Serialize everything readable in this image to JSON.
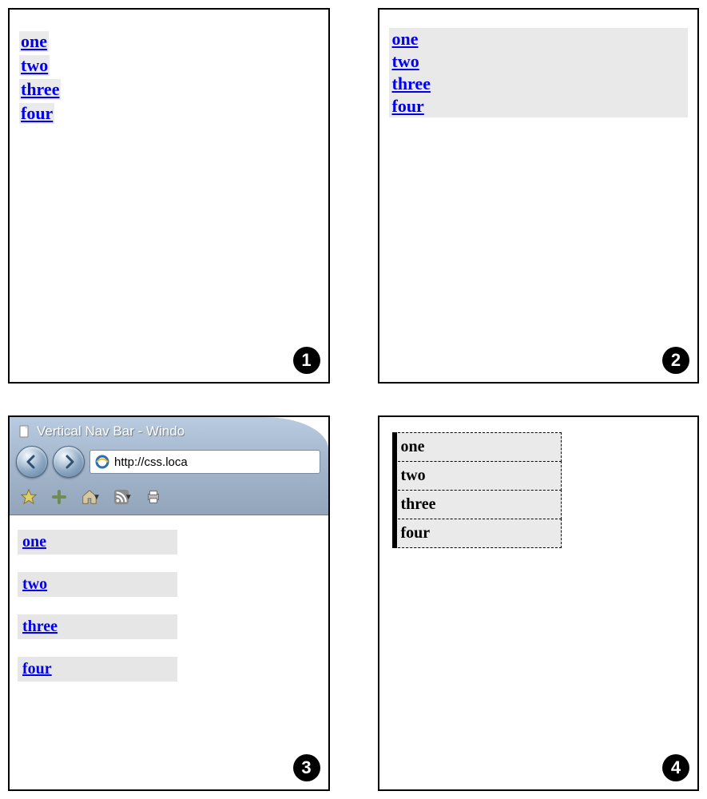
{
  "nav_items": [
    "one",
    "two",
    "three",
    "four"
  ],
  "panel_labels": {
    "p1": "1",
    "p2": "2",
    "p3": "3",
    "p4": "4"
  },
  "ie": {
    "title": "Vertical Nav Bar - Windo",
    "url": "http://css.loca"
  }
}
